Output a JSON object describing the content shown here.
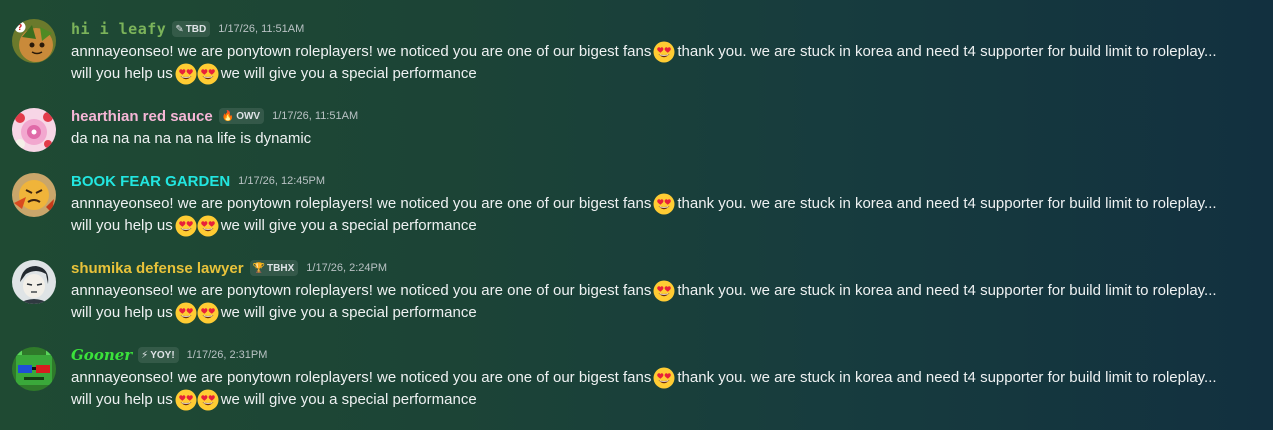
{
  "colors": {
    "leafy": "#7bb35a",
    "hearthian": "#f5b6d6",
    "book": "#22e6e0",
    "shumika": "#e8c23a",
    "gooner": "#3be23b"
  },
  "messages": [
    {
      "username": "hi i leafy",
      "tag": "TBD",
      "tag_icon": "pen-icon",
      "timestamp": "1/17/26, 11:51AM",
      "line1_a": "annnayeonseo! we are ponytown roleplayers! we noticed you are one of our bigest fans",
      "line1_b": "thank you. we are stuck in korea and need t4 supporter for build limit to roleplay...",
      "line2_a": "will you help us",
      "line2_b": "we will give you a special performance"
    },
    {
      "username": "hearthian red sauce",
      "tag": "OWV",
      "tag_icon": "flame-icon",
      "timestamp": "1/17/26, 11:51AM",
      "line1": "da na na na na na na life is dynamic"
    },
    {
      "username": "BOOK FEAR GARDEN",
      "timestamp": "1/17/26, 12:45PM",
      "line1_a": "annnayeonseo! we are ponytown roleplayers! we noticed you are one of our bigest fans",
      "line1_b": "thank you. we are stuck in korea and need t4 supporter for build limit to roleplay...",
      "line2_a": "will you help us",
      "line2_b": "we will give you a special performance"
    },
    {
      "username": "shumika defense lawyer",
      "tag": "TBHX",
      "tag_icon": "trophy-icon",
      "timestamp": "1/17/26, 2:24PM",
      "line1_a": "annnayeonseo! we are ponytown roleplayers! we noticed you are one of our bigest fans",
      "line1_b": "thank you. we are stuck in korea and need t4 supporter for build limit to roleplay...",
      "line2_a": "will you help us",
      "line2_b": "we will give you a special performance"
    },
    {
      "username": "Gooner",
      "tag": "YOY!",
      "tag_icon": "lightning-icon",
      "timestamp": "1/17/26, 2:31PM",
      "line1_a": "annnayeonseo! we are ponytown roleplayers! we noticed you are one of our bigest fans",
      "line1_b": "thank you. we are stuck in korea and need t4 supporter for build limit to roleplay...",
      "line2_a": "will you help us",
      "line2_b": "we will give you a special performance"
    }
  ],
  "emoji": "heart-eyes-emoji",
  "icons": {
    "pen": "✎",
    "flame": "🔥",
    "trophy": "🏆",
    "lightning": "⚡"
  }
}
